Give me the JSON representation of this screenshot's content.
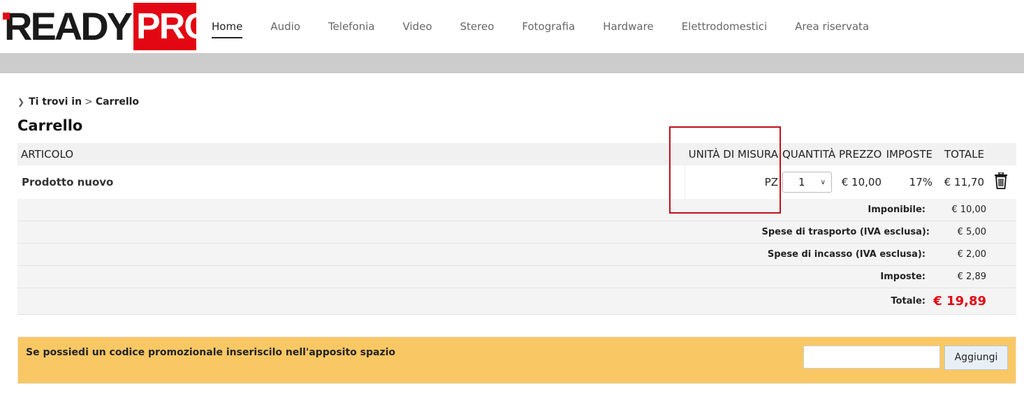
{
  "brand": {
    "ready": "READY",
    "pro": "PRO"
  },
  "nav": [
    {
      "label": "Home",
      "active": true
    },
    {
      "label": "Audio"
    },
    {
      "label": "Telefonia"
    },
    {
      "label": "Video"
    },
    {
      "label": "Stereo"
    },
    {
      "label": "Fotografia"
    },
    {
      "label": "Hardware"
    },
    {
      "label": "Elettrodomestici"
    },
    {
      "label": "Area riservata"
    }
  ],
  "breadcrumb": {
    "prefix": "Ti trovi in",
    "separator": ">",
    "current": "Carrello"
  },
  "page_title": "Carrello",
  "table": {
    "headers": {
      "articolo": "ARTICOLO",
      "unita": "UNITÀ DI MISURA",
      "quantita": "QUANTITÀ",
      "prezzo": "PREZZO",
      "imposte": "IMPOSTE",
      "totale": "TOTALE"
    },
    "rows": [
      {
        "articolo": "Prodotto nuovo",
        "unita": "PZ",
        "quantita": "1",
        "prezzo": "€ 10,00",
        "imposte": "17%",
        "totale": "€ 11,70"
      }
    ]
  },
  "summary": {
    "imponibile_label": "Imponibile:",
    "imponibile_value": "€ 10,00",
    "trasporto_label": "Spese di trasporto (IVA esclusa):",
    "trasporto_value": "€ 5,00",
    "incasso_label": "Spese di incasso (IVA esclusa):",
    "incasso_value": "€ 2,00",
    "imposte_label": "Imposte:",
    "imposte_value": "€ 2,89",
    "totale_label": "Totale:",
    "totale_value": "€ 19,89"
  },
  "promo": {
    "text": "Se possiedi un codice promozionale inseriscilo nell'apposito spazio",
    "input_value": "",
    "button_label": "Aggiungi"
  },
  "colors": {
    "brand_red": "#e30613",
    "promo_bg": "#f9c864",
    "highlight": "#c0121d"
  }
}
